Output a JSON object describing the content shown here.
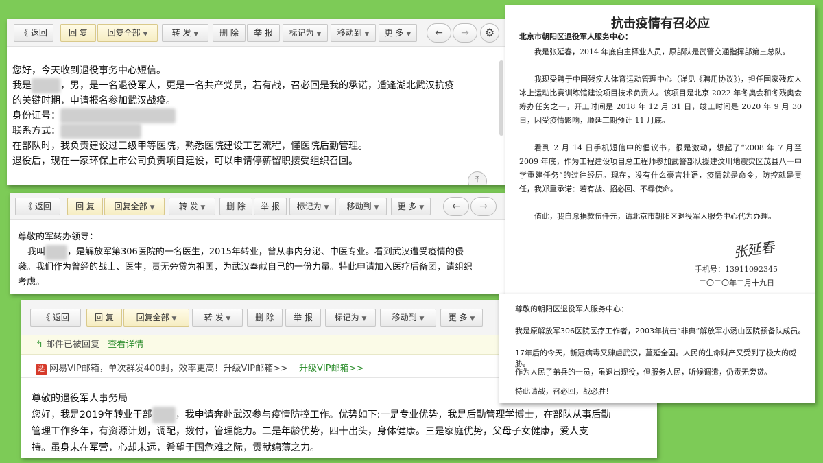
{
  "toolbar1": {
    "back": "《 返回",
    "reply": "回 复",
    "reply_all": "回复全部",
    "forward": "转 发",
    "delete": "删 除",
    "report": "举 报",
    "mark_as": "标记为",
    "move_to": "移动到",
    "more": "更 多"
  },
  "email1": {
    "lines": [
      "您好，今天收到退役事务中心短信。",
      "我是",
      "，男，是一名退役军人，更是一名共产党员，若有战，召必回是我的承诺，适逢湖北武汉抗疫",
      "的关键时期，申请报名参加武汉战疫。",
      "身份证号：",
      "联系方式：",
      "在部队时，我负责建设过三级甲等医院，熟悉医院建设工艺流程，懂医院后勤管理。",
      "退役后，现在一家环保上市公司负责项目建设，可以申请停薪留职接受组织召回。"
    ]
  },
  "toolbar2": {
    "back": "《 返回",
    "reply": "回 复",
    "reply_all": "回复全部",
    "forward": "转 发",
    "delete": "删 除",
    "report": "举 报",
    "mark_as": "标记为",
    "move_to": "移动到",
    "more": "更 多"
  },
  "email2": {
    "greeting": "尊敬的军转办领导：",
    "line1a": "我叫",
    "line1b": "，是解放军第306医院的一名医生，2015年转业，曾从事内分泌、中医专业。看到武汉遭受疫情的侵",
    "line2": "袭。我们作为曾经的战士、医生，责无旁贷为祖国，为武汉奉献自己的一份力量。特此申请加入医疗后备团，请组织",
    "line3": "考虑。"
  },
  "toolbar3": {
    "back": "《 返回",
    "reply": "回 复",
    "reply_all": "回复全部",
    "forward": "转 发",
    "delete": "删 除",
    "report": "举 报",
    "mark_as": "标记为",
    "move_to": "移动到",
    "more": "更 多"
  },
  "email3": {
    "replied_notice": "邮件已被回复",
    "view_details": "查看详情",
    "ad_text": "网易VIP邮箱，单次群发400封，效率更高！升级VIP邮箱>>",
    "ad_link": "升级VIP邮箱>>",
    "ad_icon_label": "选",
    "greeting": "尊敬的退役军人事务局",
    "line1a": "您好，我是2019年转业干部",
    "line1b": "，我申请奔赴武汉参与疫情防控工作。优势如下:一是专业优势，我是后勤管理学博士，在部队从事后勤",
    "line2": "管理工作多年，有资源计划，调配，拨付，管理能力。二是年龄优势，四十出头，身体健康。三是家庭优势，父母子女健康，爱人支",
    "line3": "持。虽身未在军营，心却未远，希望于国危难之际，贡献绵薄之力。"
  },
  "letter1": {
    "title": "抗击疫情有召必应",
    "addressee": "北京市朝阳区退役军人服务中心：",
    "p1": "我是张延春，2014 年底自主择业人员，原部队是武警交通指挥部第三总队。",
    "p2": "我现受聘于中国残疾人体育运动管理中心（详见《聘用协议》)，担任国家残疾人冰上运动比赛训练馆建设项目技术负责人。该项目是北京 2022 年冬奥会和冬残奥会筹办任务之一，开工时间是 2018 年 12 月 31 日，竣工时间是 2020 年 9 月 30 日，因受疫情影响，顺延工期预计 11 月底。",
    "p3": "看到 2 月 14 日手机短信中的倡议书，很是激动，想起了“2008 年 7 月至 2009 年底，作为工程建设项目总工程师参加武警部队援建汶川地震灾区茂县八一中学重建任务”的过往经历。现在，没有什么豪言壮语，疫情就是命令，防控就是责任，我郑重承诺：若有战、招必回、不辱使命。",
    "p4": "值此，我自愿捐款伍仟元，请北京市朝阳区退役军人服务中心代为办理。",
    "signature": "张延春",
    "phone": "手机号：13911092345",
    "date": "二〇二〇年二月十九日"
  },
  "letter2": {
    "addressee": "尊敬的朝阳区退役军人服务中心：",
    "p1": "我是原解放军306医院医疗工作者，2003年抗击“非典”解放军小汤山医院预备队成员。",
    "p2": "17年后的今天，新冠病毒又肆虐武汉，蔓延全国。人民的生命财产又受到了极大的威胁。",
    "p3": "作为人民子弟兵的一员，虽退出现役，但服务人民，听候调遣，仍责无旁贷。",
    "p4": "特此请战，召必回，战必胜！"
  }
}
